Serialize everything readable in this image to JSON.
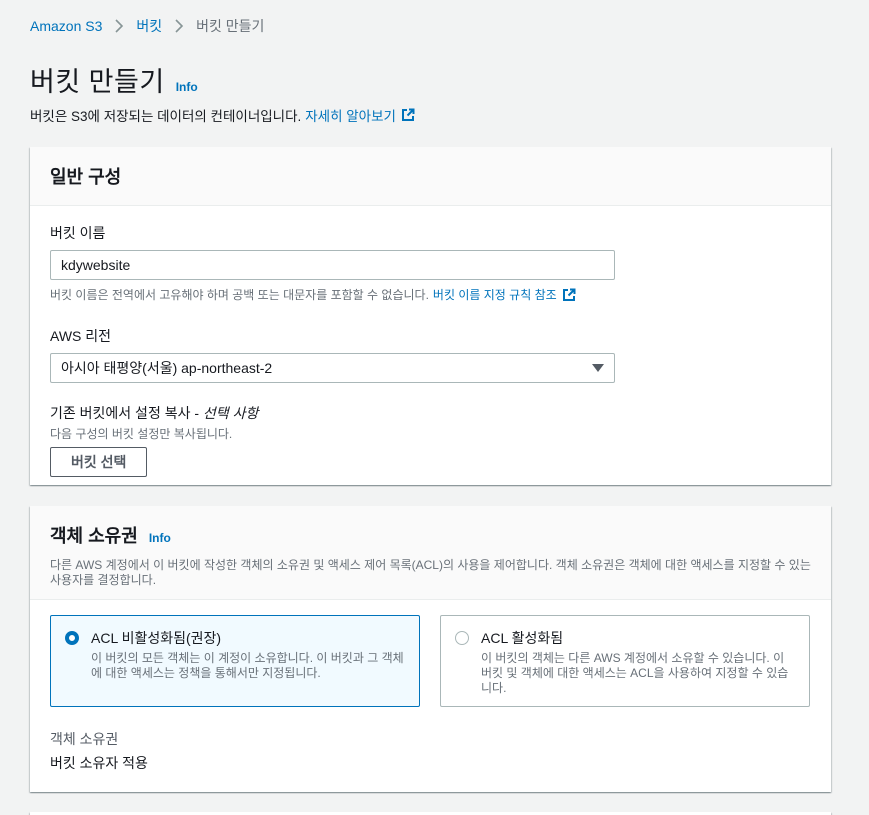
{
  "breadcrumb": {
    "items": [
      "Amazon S3",
      "버킷",
      "버킷 만들기"
    ]
  },
  "header": {
    "title": "버킷 만들기",
    "info": "Info",
    "description": "버킷은 S3에 저장되는 데이터의 컨테이너입니다.",
    "learn_more": "자세히 알아보기"
  },
  "general": {
    "title": "일반 구성",
    "bucket_name_label": "버킷 이름",
    "bucket_name_value": "kdywebsite",
    "bucket_name_hint": "버킷 이름은 전역에서 고유해야 하며 공백 또는 대문자를 포함할 수 없습니다.",
    "bucket_name_rules_link": "버킷 이름 지정 규칙 참조",
    "region_label": "AWS 리전",
    "region_value": "아시아 태평양(서울) ap-northeast-2",
    "copy_label": "기존 버킷에서 설정 복사 - ",
    "copy_optional": "선택 사항",
    "copy_hint": "다음 구성의 버킷 설정만 복사됩니다.",
    "choose_bucket_button": "버킷 선택"
  },
  "ownership": {
    "title": "객체 소유권",
    "info": "Info",
    "description": "다른 AWS 계정에서 이 버킷에 작성한 객체의 소유권 및 액세스 제어 목록(ACL)의 사용을 제어합니다. 객체 소유권은 객체에 대한 액세스를 지정할 수 있는 사용자를 결정합니다.",
    "options": [
      {
        "label": "ACL 비활성화됨(권장)",
        "description": "이 버킷의 모든 객체는 이 계정이 소유합니다. 이 버킷과 그 객체에 대한 액세스는 정책을 통해서만 지정됩니다.",
        "selected": true
      },
      {
        "label": "ACL 활성화됨",
        "description": "이 버킷의 객체는 다른 AWS 계정에서 소유할 수 있습니다. 이 버킷 및 객체에 대한 액세스는 ACL을 사용하여 지정할 수 있습니다.",
        "selected": false
      }
    ],
    "owner_label": "객체 소유권",
    "owner_value": "버킷 소유자 적용"
  },
  "colors": {
    "link": "#0073bb",
    "selected_tile_bg": "#f1faff",
    "page_bg": "#f2f3f3"
  }
}
